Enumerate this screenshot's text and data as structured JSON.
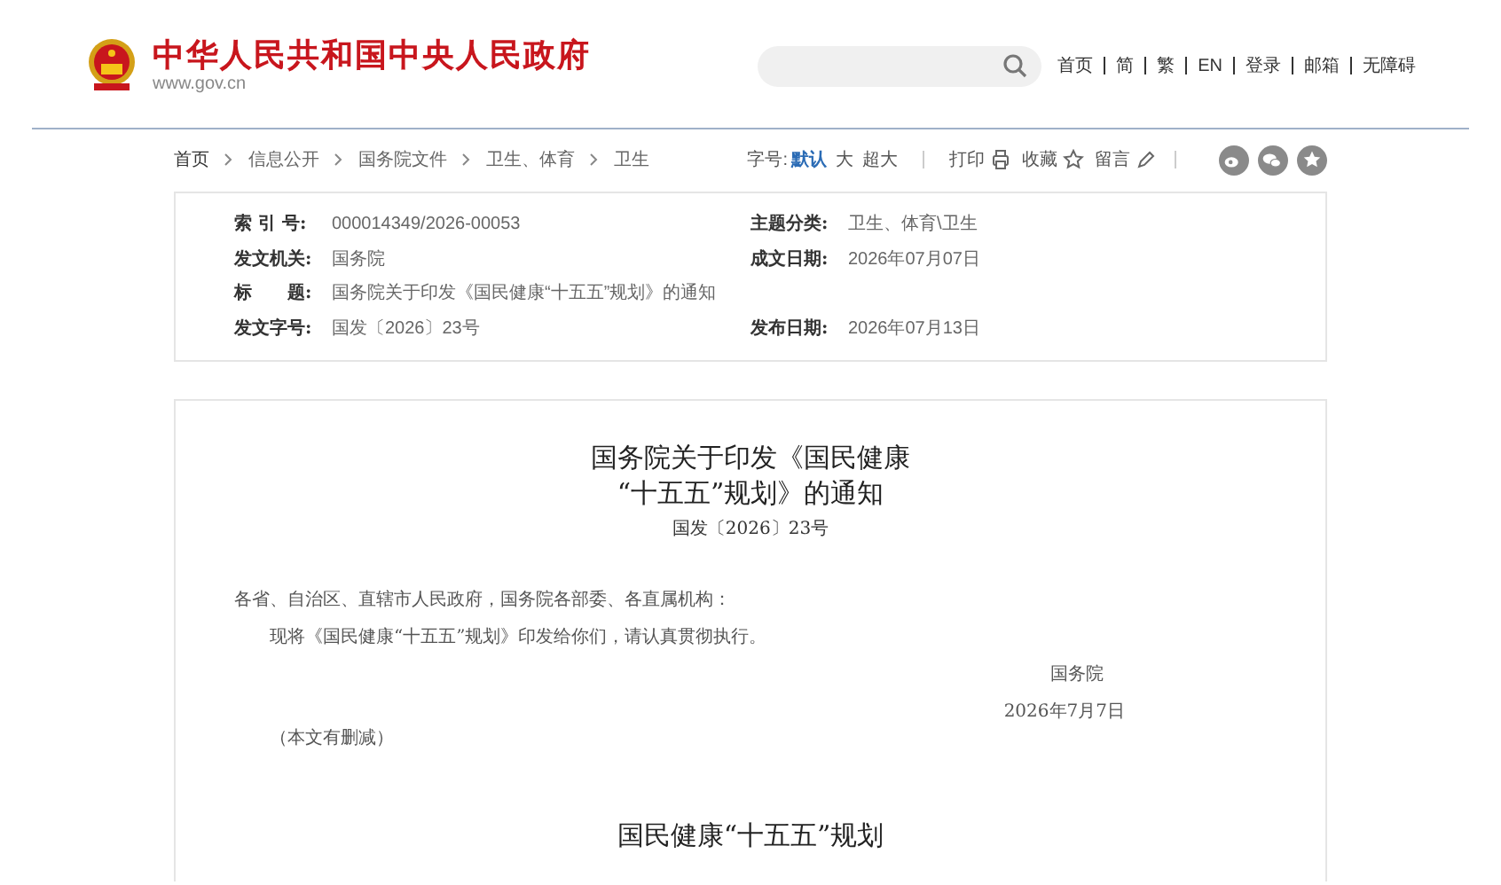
{
  "header": {
    "site_title": "中华人民共和国中央人民政府",
    "site_url": "www.gov.cn",
    "nav_links": [
      "首页",
      "简",
      "繁",
      "EN",
      "登录",
      "邮箱",
      "无障碍"
    ]
  },
  "breadcrumb": [
    "首页",
    "信息公开",
    "国务院文件",
    "卫生、体育",
    "卫生"
  ],
  "font_size": {
    "label": "字号:",
    "options": [
      {
        "label": "默认",
        "selected": true
      },
      {
        "label": "大",
        "selected": false
      },
      {
        "label": "超大",
        "selected": false
      }
    ]
  },
  "tools": [
    {
      "kind": "print",
      "label": "打印"
    },
    {
      "kind": "favorite",
      "label": "收藏"
    },
    {
      "kind": "comment",
      "label": "留言"
    }
  ],
  "share": [
    {
      "kind": "weibo"
    },
    {
      "kind": "wechat"
    },
    {
      "kind": "star"
    }
  ],
  "metadata": [
    {
      "label": "索 引 号:",
      "value": "000014349/2026-00053",
      "label2": "主题分类:",
      "value2": "卫生、体育\\卫生"
    },
    {
      "label": "发文机关:",
      "value": "国务院",
      "label2": "成文日期:",
      "value2": "2026年07月07日"
    },
    {
      "label": "标　　题:",
      "value": "国务院关于印发《国民健康“十五五”规划》的通知"
    },
    {
      "label": "发文字号:",
      "value": "国发〔2026〕23号",
      "label2": "发布日期:",
      "value2": "2026年07月13日"
    }
  ],
  "document": {
    "title_lines": [
      "国务院关于印发《国民健康",
      "“十五五”规划》的通知"
    ],
    "doc_number": "国发〔2026〕23号",
    "salutation": "各省、自治区、直辖市人民政府，国务院各部委、各直属机构：",
    "body": "现将《国民健康“十五五”规划》印发给你们，请认真贯彻执行。",
    "signature": "国务院",
    "date": "2026年7月7日",
    "note": "（本文有删减）",
    "section_title": "国民健康“十五五”规划"
  }
}
